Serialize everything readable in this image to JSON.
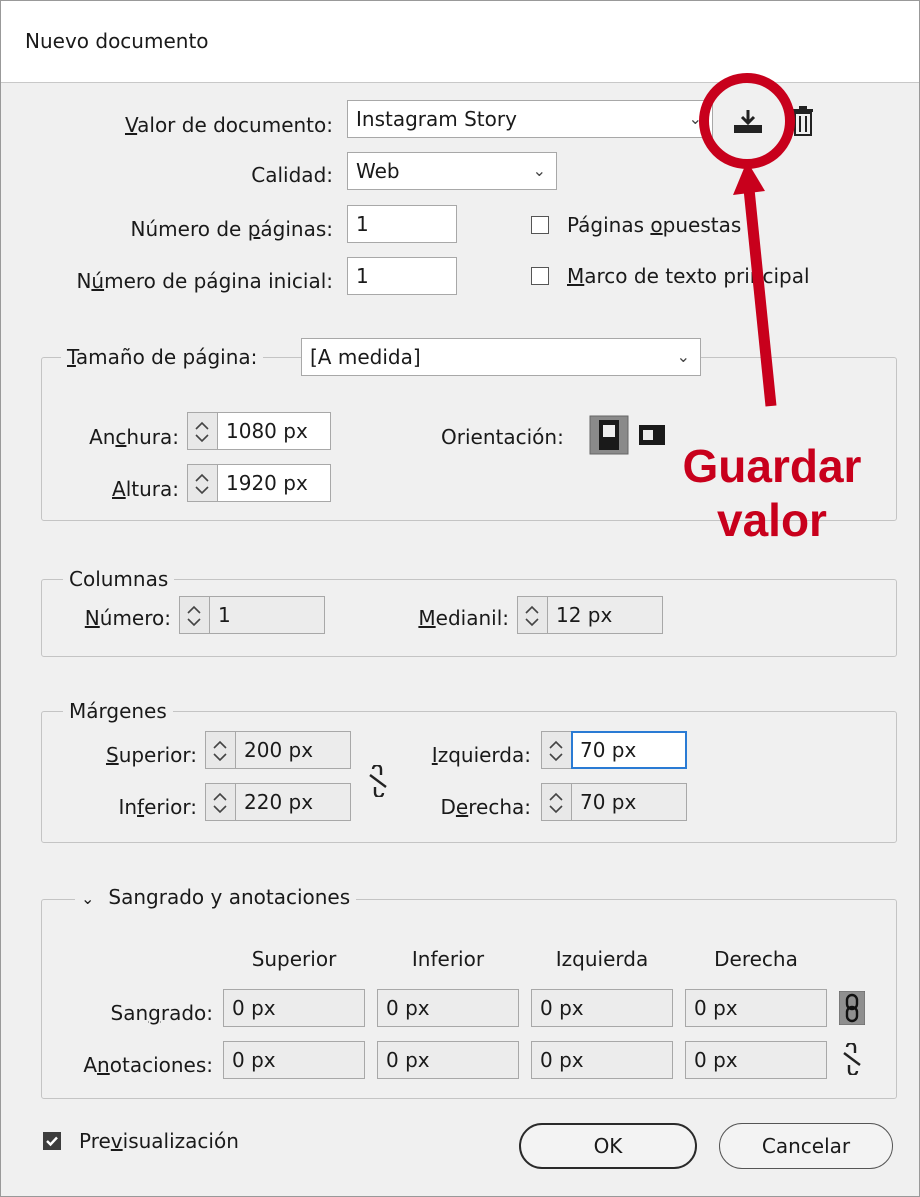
{
  "window": {
    "title": "Nuevo documento"
  },
  "preset": {
    "label": "Valor de documento:",
    "value": "Instagram Story"
  },
  "quality": {
    "label": "Calidad:",
    "value": "Web"
  },
  "pages": {
    "label": "Número de páginas:",
    "value": "1"
  },
  "start_page": {
    "label": "Número de página inicial:",
    "value": "1"
  },
  "facing_pages": {
    "label": "Páginas opuestas",
    "checked": false
  },
  "primary_text_frame": {
    "label": "Marco de texto principal",
    "checked": false
  },
  "page_size": {
    "label": "Tamaño de página:",
    "value": "[A medida]",
    "width_label": "Anchura:",
    "width": "1080 px",
    "height_label": "Altura:",
    "height": "1920 px",
    "orientation_label": "Orientación:",
    "orientation": "portrait"
  },
  "columns": {
    "legend": "Columnas",
    "number_label": "Número:",
    "number": "1",
    "gutter_label": "Medianil:",
    "gutter": "12 px"
  },
  "margins": {
    "legend": "Márgenes",
    "top_label": "Superior:",
    "top": "200 px",
    "bottom_label": "Inferior:",
    "bottom": "220 px",
    "left_label": "Izquierda:",
    "left": "70 px",
    "right_label": "Derecha:",
    "right": "70 px"
  },
  "bleed_slug": {
    "legend": "Sangrado y anotaciones",
    "columns": [
      "Superior",
      "Inferior",
      "Izquierda",
      "Derecha"
    ],
    "bleed_label": "Sangrado:",
    "bleed": [
      "0 px",
      "0 px",
      "0 px",
      "0 px"
    ],
    "slug_label": "Anotaciones:",
    "slug": [
      "0 px",
      "0 px",
      "0 px",
      "0 px"
    ]
  },
  "preview": {
    "label": "Previsualización",
    "checked": true
  },
  "buttons": {
    "ok": "OK",
    "cancel": "Cancelar"
  },
  "annotation": {
    "line1": "Guardar",
    "line2": "valor",
    "color": "#c8001c"
  },
  "icons": [
    "save-preset-icon",
    "delete-preset-icon",
    "portrait-icon",
    "landscape-icon",
    "link-icon",
    "unlink-icon",
    "chevron-down-icon",
    "check-icon"
  ]
}
